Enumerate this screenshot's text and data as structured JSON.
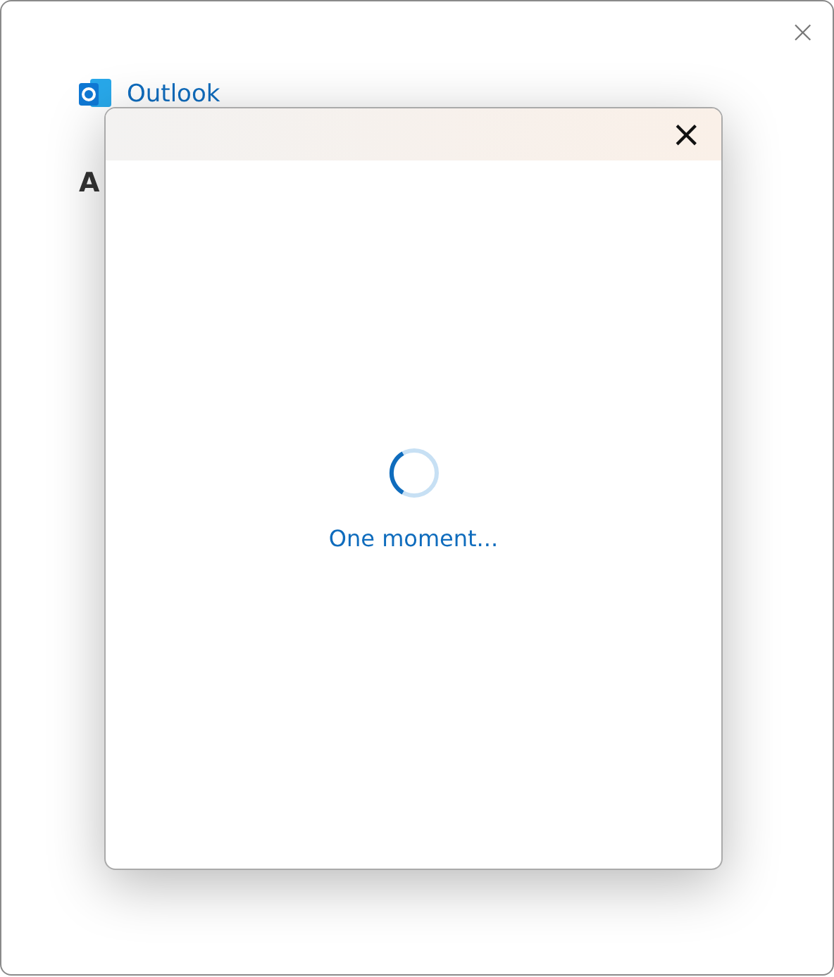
{
  "window": {
    "close_glyph": "×"
  },
  "brand": {
    "name": "Outlook"
  },
  "heading": "A",
  "dialog": {
    "close_glyph": "×",
    "message": "One moment...",
    "busy": true
  }
}
